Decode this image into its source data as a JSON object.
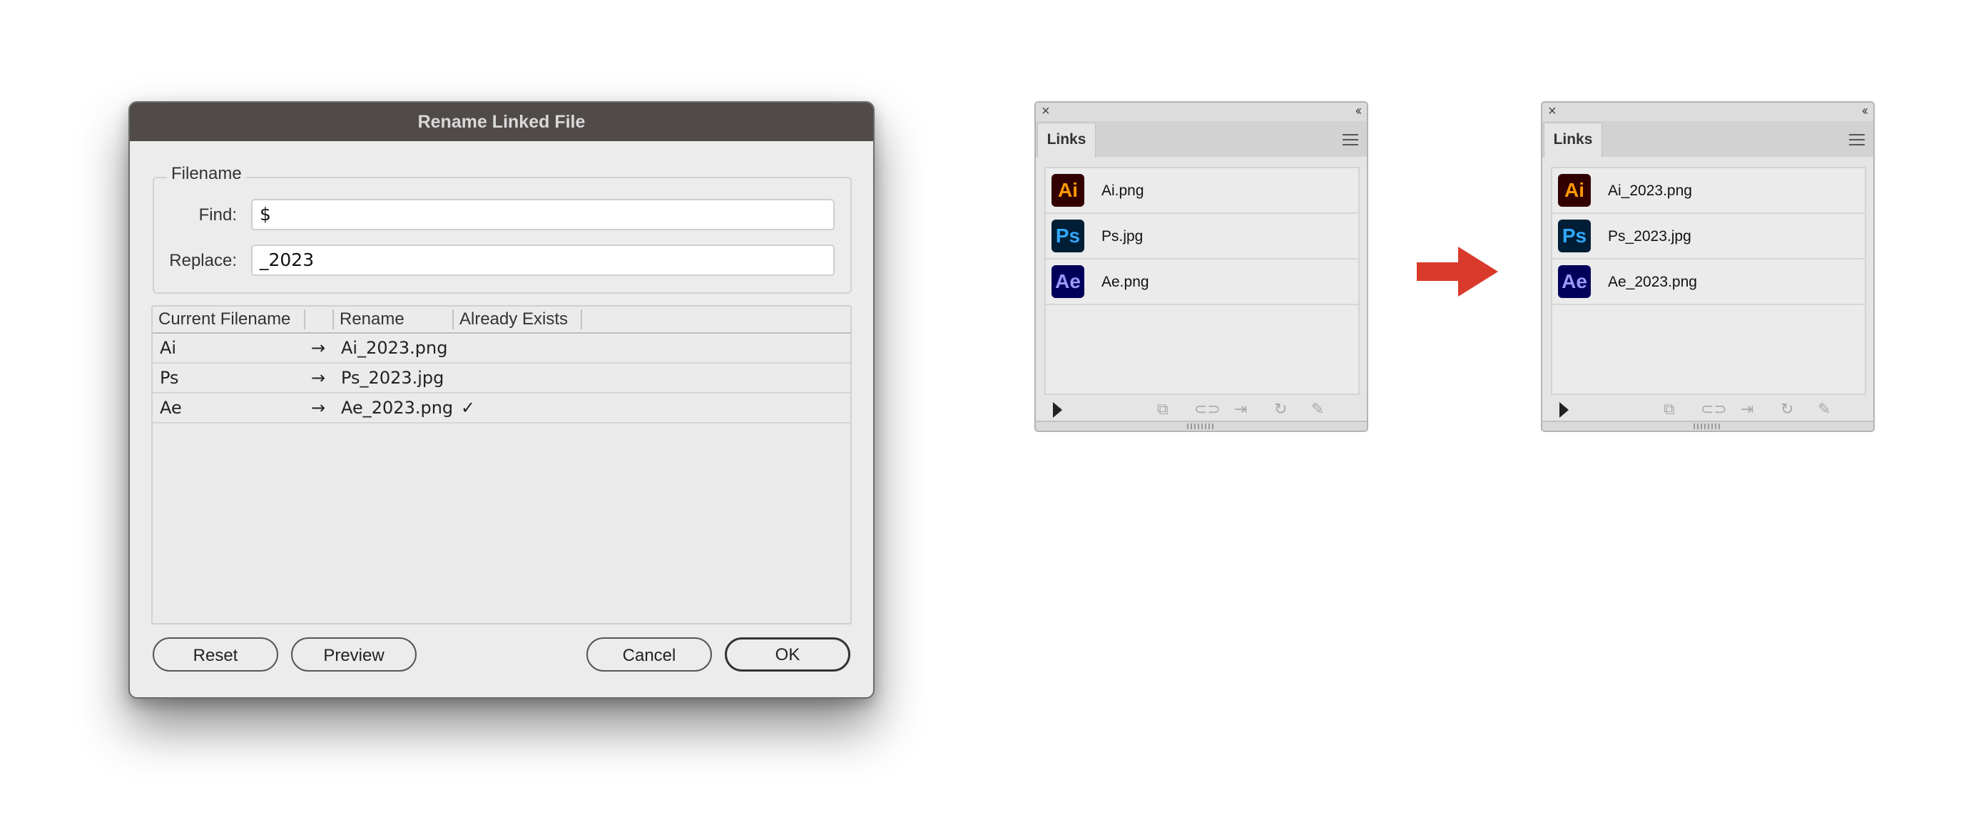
{
  "dialog": {
    "title": "Rename Linked File",
    "group_title": "Filename",
    "find_label": "Find:",
    "find_value": "$",
    "replace_label": "Replace:",
    "replace_value": "_2023",
    "table": {
      "headers": [
        "Current Filename",
        "Rename",
        "Already Exists"
      ],
      "rows": [
        {
          "current": "Ai",
          "arrow": "→",
          "rename": "Ai_2023.png",
          "exists": ""
        },
        {
          "current": "Ps",
          "arrow": "→",
          "rename": "Ps_2023.jpg",
          "exists": ""
        },
        {
          "current": "Ae",
          "arrow": "→",
          "rename": "Ae_2023.png",
          "exists": "✓"
        }
      ]
    },
    "buttons": {
      "reset": "Reset",
      "preview": "Preview",
      "cancel": "Cancel",
      "ok": "OK"
    }
  },
  "panel_before": {
    "tab": "Links",
    "items": [
      {
        "icon": "Ai",
        "name": "Ai.png"
      },
      {
        "icon": "Ps",
        "name": "Ps.jpg"
      },
      {
        "icon": "Ae",
        "name": "Ae.png"
      }
    ]
  },
  "panel_after": {
    "tab": "Links",
    "items": [
      {
        "icon": "Ai",
        "name": "Ai_2023.png"
      },
      {
        "icon": "Ps",
        "name": "Ps_2023.jpg"
      },
      {
        "icon": "Ae",
        "name": "Ae_2023.png"
      }
    ]
  },
  "icons": {
    "close": "×",
    "collapse": "‹‹",
    "tools": [
      "relink-icon",
      "goto-link-icon",
      "embed-icon",
      "update-icon",
      "edit-original-icon"
    ]
  },
  "colors": {
    "titlebar": "#504b49",
    "arrow": "#d93a2b",
    "ai_bg": "#330000",
    "ai_fg": "#ff9a00",
    "ps_bg": "#001e36",
    "ps_fg": "#31a8ff",
    "ae_bg": "#00005b",
    "ae_fg": "#9999ff"
  }
}
